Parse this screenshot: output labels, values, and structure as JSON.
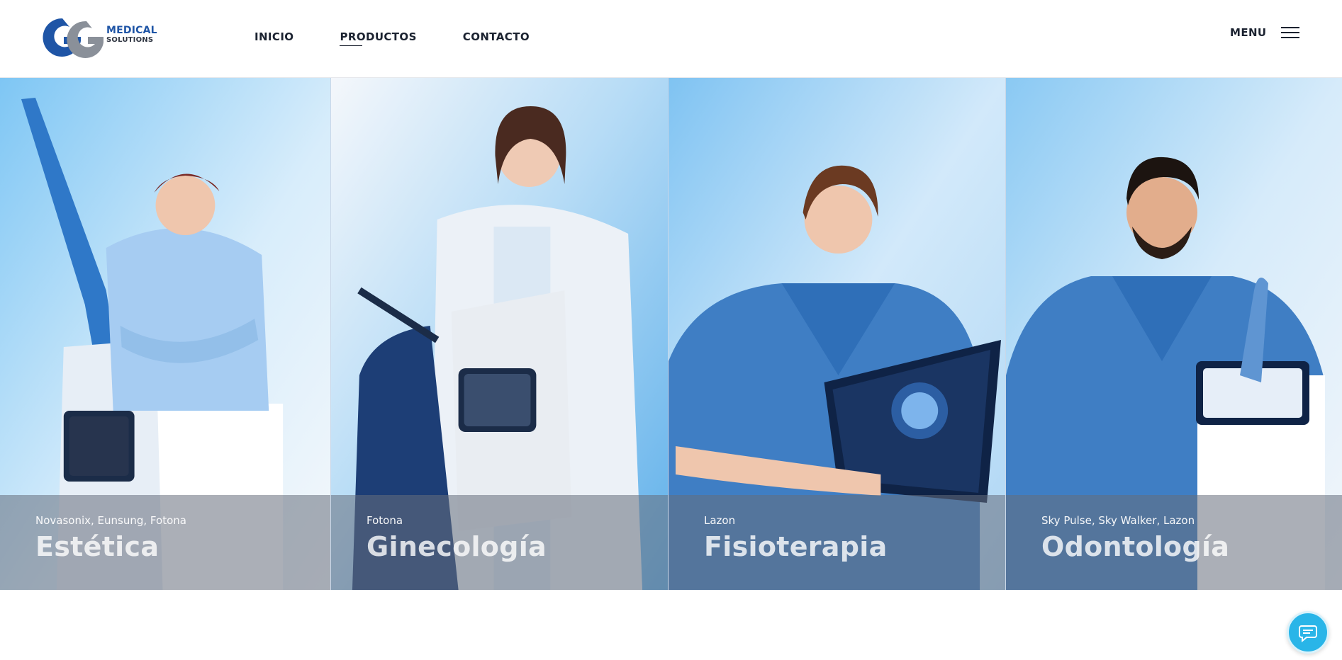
{
  "brand": {
    "line1": "MEDICAL",
    "line2": "SOLUTIONS"
  },
  "nav": {
    "items": [
      "INICIO",
      "PRODUCTOS",
      "CONTACTO"
    ],
    "active": "PRODUCTOS"
  },
  "menu": {
    "label": "MENU",
    "icon": "hamburger-icon"
  },
  "cards": [
    {
      "brands": "Novasonix, Eunsung, Fotona",
      "category": "Estética"
    },
    {
      "brands": "Fotona",
      "category": "Ginecología"
    },
    {
      "brands": "Lazon",
      "category": "Fisioterapia"
    },
    {
      "brands": "Sky Pulse, Sky Walker, Lazon",
      "category": "Odontología"
    }
  ],
  "chat": {
    "icon": "chat-bubble-icon"
  },
  "colors": {
    "brand_blue": "#1f55a6",
    "brand_gray": "#8a9099",
    "scrub_blue": "#3f7ec4",
    "chat_accent": "#29b5e8"
  }
}
